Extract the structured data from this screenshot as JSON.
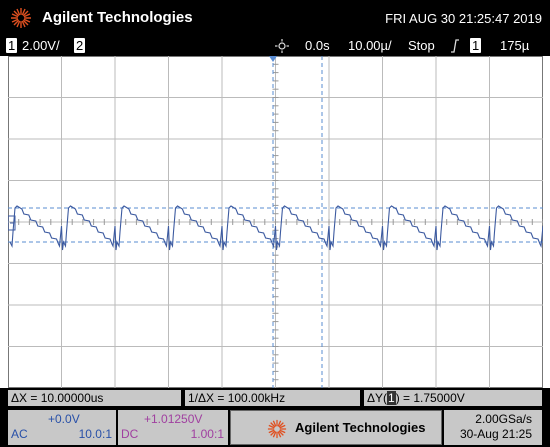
{
  "header": {
    "brand": "Agilent Technologies",
    "datetime": "FRI AUG 30 21:25:47 2019"
  },
  "status": {
    "channel1": "1",
    "channel1_scale": "2.00V/",
    "channel2": "2",
    "horizontal_position": "0.0s",
    "timebase": "10.00µ/",
    "run_state": "Stop",
    "trigger_source": "1",
    "trigger_level": "175µ"
  },
  "measurements": {
    "delta_x": "ΔX = 10.00000us",
    "inverse_delta_x": "1/ΔX = 100.00kHz",
    "delta_y_prefix": "ΔY(",
    "delta_y_channel": "1",
    "delta_y_suffix": ") = 1.75000V"
  },
  "channel_info": {
    "ch1_offset": "+0.0V",
    "ch1_coupling": "AC",
    "ch1_probe": "10.0:1",
    "ch2_offset": "+1.01250V",
    "ch2_coupling": "DC",
    "ch2_probe": "1.00:1"
  },
  "footer": {
    "brand": "Agilent Technologies",
    "sample_rate": "2.00GSa/s",
    "date": "30-Aug 21:25"
  },
  "colors": {
    "trace": "#3c5aa0",
    "cursor": "#5a8cd2",
    "grid": "#bbbbbb",
    "ch2": "#a040a0"
  },
  "icons": [
    "agilent-spark-logo",
    "trigger-position-icon",
    "trigger-edge-icon",
    "ground-marker-icon"
  ]
}
